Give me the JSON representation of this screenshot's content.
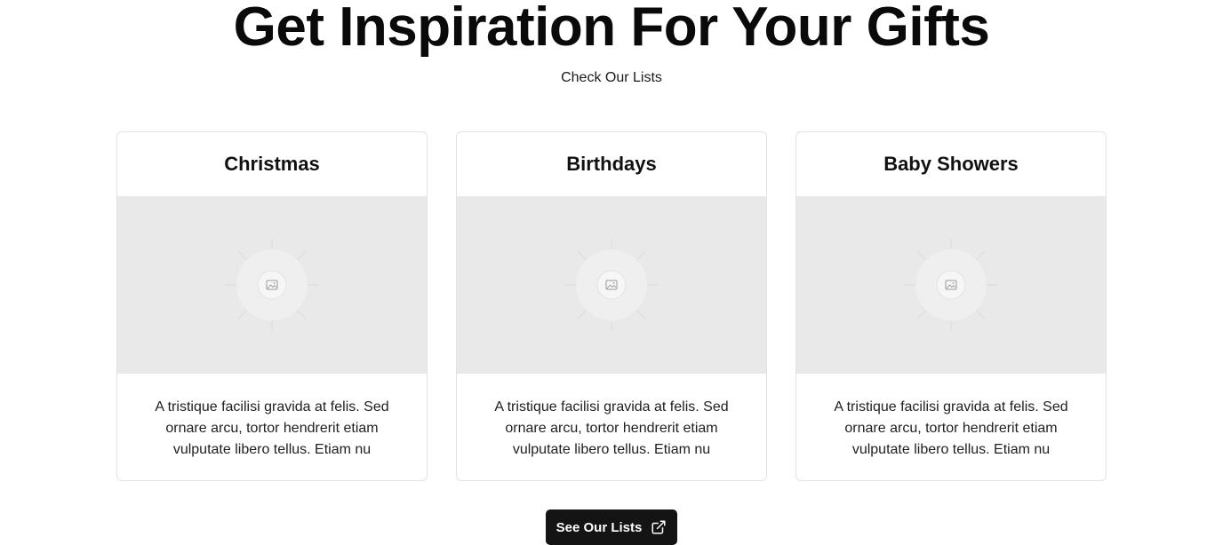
{
  "hero": {
    "title": "Get Inspiration For Your Gifts",
    "subtitle": "Check Our Lists"
  },
  "cards": [
    {
      "title": "Christmas",
      "image_icon": "image-placeholder-icon",
      "description": "A tristique facilisi gravida at felis. Sed ornare arcu, tortor hendrerit etiam vulputate libero tellus. Etiam nu"
    },
    {
      "title": "Birthdays",
      "image_icon": "image-placeholder-icon",
      "description": "A tristique facilisi gravida at felis. Sed ornare arcu, tortor hendrerit etiam vulputate libero tellus. Etiam nu"
    },
    {
      "title": "Baby Showers",
      "image_icon": "image-placeholder-icon",
      "description": "A tristique facilisi gravida at felis. Sed ornare arcu, tortor hendrerit etiam vulputate libero tellus. Etiam nu"
    }
  ],
  "cta": {
    "label": "See Our Lists",
    "icon": "external-link-icon"
  },
  "colors": {
    "text": "#111111",
    "button_bg": "#141414",
    "image_bg": "#e9e9e9",
    "card_border": "#e3e3e3"
  }
}
